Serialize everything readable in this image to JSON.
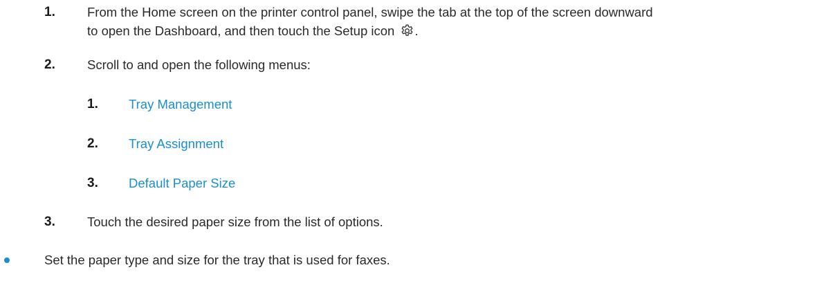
{
  "steps": [
    {
      "number": "1.",
      "line1": "From the Home screen on the printer control panel, swipe the tab at the top of the screen downward",
      "line2": "to open the Dashboard, and then touch the Setup icon",
      "line2_end": "."
    },
    {
      "number": "2.",
      "text": "Scroll to and open the following menus:",
      "substeps": [
        {
          "number": "1.",
          "label": "Tray Management"
        },
        {
          "number": "2.",
          "label": "Tray Assignment"
        },
        {
          "number": "3.",
          "label": "Default Paper Size"
        }
      ]
    },
    {
      "number": "3.",
      "text": "Touch the desired paper size from the list of options."
    }
  ],
  "bullet_item": "Set the paper type and size for the tray that is used for faxes.",
  "icons": {
    "setup": "gear-icon"
  },
  "colors": {
    "link": "#1a8fcf",
    "bullet": "#1a8fcf",
    "text": "#2a2a2a"
  }
}
